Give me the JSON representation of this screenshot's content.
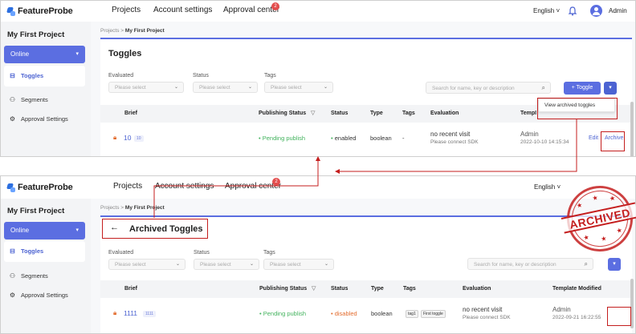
{
  "brand": {
    "name": "FeatureProbe"
  },
  "nav": {
    "projects": "Projects",
    "account_settings": "Account settings",
    "approval_center": "Approval center",
    "approval_badge": "2"
  },
  "header": {
    "language": "English",
    "language_icon": "chevron-down-icon",
    "bell_icon": "bell-icon",
    "user": "Admin"
  },
  "sidebar": {
    "project": "My First Project",
    "environment": "Online",
    "items": [
      {
        "label": "Toggles",
        "icon": "toggle-icon"
      },
      {
        "label": "Segments",
        "icon": "users-icon"
      },
      {
        "label": "Approval Settings",
        "icon": "gear-icon"
      }
    ]
  },
  "breadcrumb": {
    "root": "Projects",
    "sep": ">",
    "current": "My First Project"
  },
  "toggles_page": {
    "title": "Toggles",
    "filters": {
      "evaluated": "Evaluated",
      "status": "Status",
      "tags": "Tags",
      "placeholder": "Please select"
    },
    "search_placeholder": "Search for name, key or description",
    "add_button": "+ Toggle",
    "dropdown_item": "View archived toggles",
    "columns": {
      "brief": "Brief",
      "publishing_status": "Publishing Status",
      "status": "Status",
      "type": "Type",
      "tags": "Tags",
      "evaluation": "Evaluation",
      "template_modified": "Template Modified"
    },
    "row": {
      "name": "10",
      "key": "10",
      "publishing": "Pending publish",
      "status": "enabled",
      "type": "boolean",
      "tags": "-",
      "eval_line1": "no recent visit",
      "eval_line2": "Please connect SDK",
      "modified_by": "Admin",
      "modified_at": "2022-10-10 14:15:34",
      "edit": "Edit",
      "archive": "Archive"
    }
  },
  "archived_page": {
    "title": "Archived Toggles",
    "stamp": "ARCHIVED",
    "filters": {
      "evaluated": "Evaluated",
      "status": "Status",
      "tags": "Tags",
      "placeholder": "Please select"
    },
    "search_placeholder": "Search for name, key or description",
    "columns": {
      "brief": "Brief",
      "publishing_status": "Publishing Status",
      "status": "Status",
      "type": "Type",
      "tags": "Tags",
      "evaluation": "Evaluation",
      "template_modified": "Template Modified"
    },
    "row": {
      "name": "1111",
      "key": "1111",
      "publishing": "Pending publish",
      "status": "disabled",
      "type": "boolean",
      "tag1": "tag1",
      "tag2": "First toggle",
      "eval_line1": "no recent visit",
      "eval_line2": "Please connect SDK",
      "modified_by": "Admin",
      "modified_at": "2022-09-21 16:22:55"
    }
  },
  "colors": {
    "accent": "#5b6ee1",
    "highlight": "#c41e1e",
    "pending": "#41b25c",
    "disabled": "#e36b2c"
  }
}
